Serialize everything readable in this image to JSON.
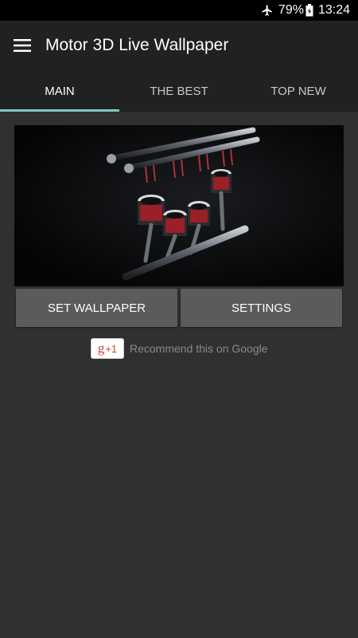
{
  "status_bar": {
    "battery_percent": "79%",
    "time": "13:24",
    "icons": [
      "airplane-icon",
      "battery-icon"
    ]
  },
  "app_bar": {
    "title": "Motor 3D Live Wallpaper",
    "menu_icon": "hamburger-menu-icon"
  },
  "tabs": [
    {
      "label": "MAIN",
      "active": true
    },
    {
      "label": "THE BEST",
      "active": false
    },
    {
      "label": "TOP NEW",
      "active": false
    }
  ],
  "buttons": {
    "set_wallpaper": "SET WALLPAPER",
    "settings": "SETTINGS"
  },
  "google_plus": {
    "badge_g": "g",
    "badge_plus": "+1",
    "text": "Recommend this on Google"
  },
  "colors": {
    "accent": "#7ec8c2",
    "app_bar": "#212121",
    "background": "#303030",
    "button": "#5b5b5b"
  }
}
